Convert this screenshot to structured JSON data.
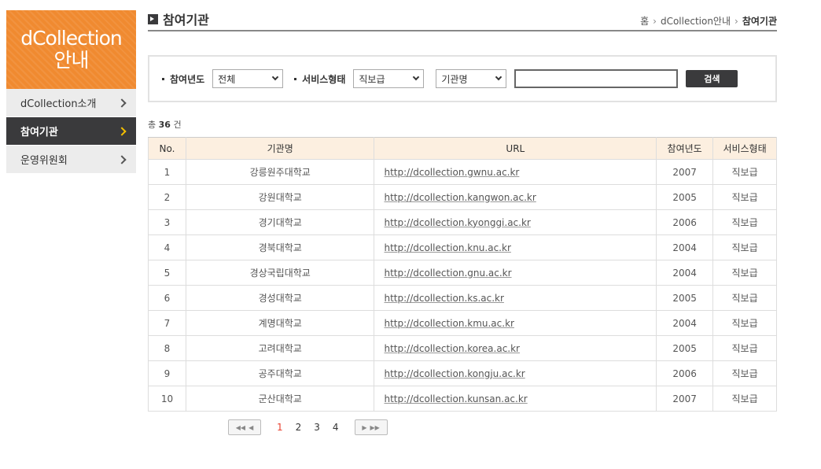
{
  "sidebar": {
    "title_line1": "dCollection",
    "title_line2": "안내",
    "items": [
      {
        "label": "dCollection소개",
        "active": false
      },
      {
        "label": "참여기관",
        "active": true
      },
      {
        "label": "운영위원회",
        "active": false
      }
    ]
  },
  "header": {
    "title": "참여기관",
    "breadcrumb": [
      "홈",
      "dCollection안내",
      "참여기관"
    ]
  },
  "search": {
    "year_label": "참여년도",
    "year_value": "전체",
    "service_label": "서비스형태",
    "service_value": "직보급",
    "field_value": "기관명",
    "query_value": "",
    "button_label": "검색"
  },
  "total": {
    "prefix": "총",
    "count": "36",
    "suffix": "건"
  },
  "table": {
    "headers": [
      "No.",
      "기관명",
      "URL",
      "참여년도",
      "서비스형태"
    ],
    "rows": [
      {
        "no": "1",
        "name": "강릉원주대학교",
        "url": "http://dcollection.gwnu.ac.kr",
        "year": "2007",
        "type": "직보급"
      },
      {
        "no": "2",
        "name": "강원대학교",
        "url": "http://dcollection.kangwon.ac.kr",
        "year": "2005",
        "type": "직보급"
      },
      {
        "no": "3",
        "name": "경기대학교",
        "url": "http://dcollection.kyonggi.ac.kr",
        "year": "2006",
        "type": "직보급"
      },
      {
        "no": "4",
        "name": "경북대학교",
        "url": "http://dcollection.knu.ac.kr",
        "year": "2004",
        "type": "직보급"
      },
      {
        "no": "5",
        "name": "경상국립대학교",
        "url": "http://dcollection.gnu.ac.kr",
        "year": "2004",
        "type": "직보급"
      },
      {
        "no": "6",
        "name": "경성대학교",
        "url": "http://dcollection.ks.ac.kr",
        "year": "2005",
        "type": "직보급"
      },
      {
        "no": "7",
        "name": "계명대학교",
        "url": "http://dcollection.kmu.ac.kr",
        "year": "2004",
        "type": "직보급"
      },
      {
        "no": "8",
        "name": "고려대학교",
        "url": "http://dcollection.korea.ac.kr",
        "year": "2005",
        "type": "직보급"
      },
      {
        "no": "9",
        "name": "공주대학교",
        "url": "http://dcollection.kongju.ac.kr",
        "year": "2006",
        "type": "직보급"
      },
      {
        "no": "10",
        "name": "군산대학교",
        "url": "http://dcollection.kunsan.ac.kr",
        "year": "2007",
        "type": "직보급"
      }
    ]
  },
  "pagination": {
    "pages": [
      "1",
      "2",
      "3",
      "4"
    ],
    "current": "1"
  },
  "colors": {
    "accent_orange": "#f08a30",
    "dark": "#3a3a3c",
    "header_bg": "#fcefe0",
    "active_page": "#e8402f"
  }
}
